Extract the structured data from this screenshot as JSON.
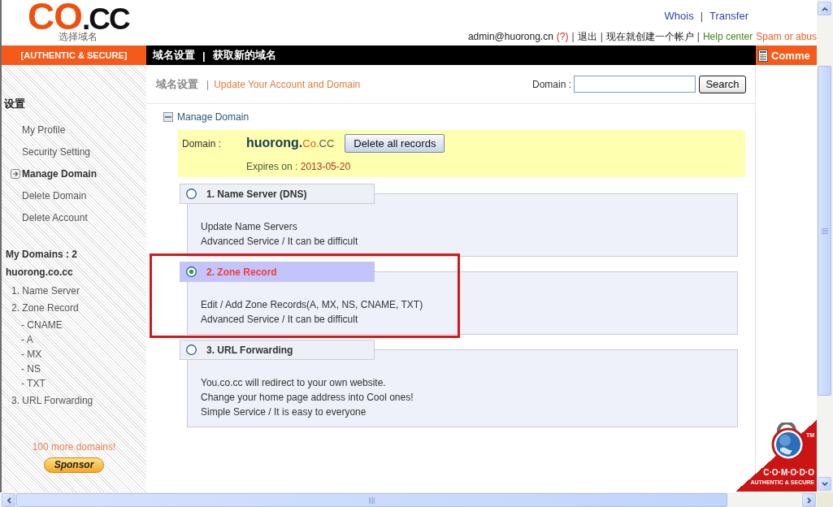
{
  "logo": {
    "mark": "CO",
    "suffix": ".CC",
    "caption": "选择域名"
  },
  "top_links": {
    "items": [
      "Whois",
      "Transfer"
    ],
    "separator": "|"
  },
  "account_bar": [
    {
      "kind": "user",
      "text": "admin@huorong.cn"
    },
    {
      "kind": "help",
      "text": "(?)"
    },
    {
      "kind": "separator",
      "text": "|"
    },
    {
      "kind": "link",
      "text": "退出"
    },
    {
      "kind": "separator",
      "text": "|"
    },
    {
      "kind": "link",
      "text": "现在就创建一个帐户"
    },
    {
      "kind": "separator",
      "text": "|"
    },
    {
      "kind": "help_center",
      "text": "Help center"
    },
    {
      "kind": "abuse",
      "text": "Spam or abus"
    }
  ],
  "nav": {
    "badge": "[AUTHENTIC & SECURE]",
    "links": [
      "域名设置",
      "获取新的域名"
    ],
    "separator": "|",
    "comment": "Comme"
  },
  "sidebar": {
    "heading": "设置",
    "items": [
      {
        "label": "My Profile",
        "selected": false
      },
      {
        "label": "Security Setting",
        "selected": false
      },
      {
        "label": "Manage Domain",
        "selected": true
      },
      {
        "label": "Delete Domain",
        "selected": false
      },
      {
        "label": "Delete Account",
        "selected": false
      }
    ],
    "domains_heading": "My Domains : 2",
    "domain": "huorong.co.cc",
    "domain_menu": [
      {
        "label": "1. Name Server"
      },
      {
        "label": "2. Zone Record",
        "children": [
          {
            "label": "- CNAME"
          },
          {
            "label": "- A"
          },
          {
            "label": "- MX"
          },
          {
            "label": "- NS"
          },
          {
            "label": "- TXT"
          }
        ]
      },
      {
        "label": "3. URL Forwarding"
      }
    ],
    "promo": "100 more domains!",
    "sponsor_button": "Sponsor"
  },
  "page_header": {
    "section": "域名设置",
    "separator": "|",
    "title": "Update Your Account and Domain",
    "search": {
      "label": "Domain :",
      "button": "Search"
    }
  },
  "manage_domain": {
    "title": "Manage Domain",
    "domain_label": "Domain :",
    "domain": {
      "name": "huorong.",
      "sld": "Co.",
      "tld": "CC"
    },
    "delete_button": "Delete all records",
    "expires_label": "Expires on : ",
    "expires_date": "2013-05-20"
  },
  "options": [
    {
      "title": "1. Name Server (DNS)",
      "selected": false,
      "annotated": false,
      "lines": [
        "Update Name Servers",
        "Advanced Service / It can be difficult"
      ]
    },
    {
      "title": "2. Zone Record",
      "selected": true,
      "annotated": true,
      "lines": [
        "Edit / Add Zone Records(A, MX, NS, CNAME, TXT)",
        "Advanced Service / It can be difficult"
      ]
    },
    {
      "title": "3. URL Forwarding",
      "selected": false,
      "annotated": false,
      "lines": [
        "You.co.cc will redirect to your own website.",
        "Change your home page address into Cool ones!",
        "Simple Service / It is easy to everyone"
      ]
    }
  ],
  "seal": {
    "trademark": "TM",
    "brand": "C·O·M·O·D·O",
    "tagline": "AUTHENTIC & SECURE"
  }
}
